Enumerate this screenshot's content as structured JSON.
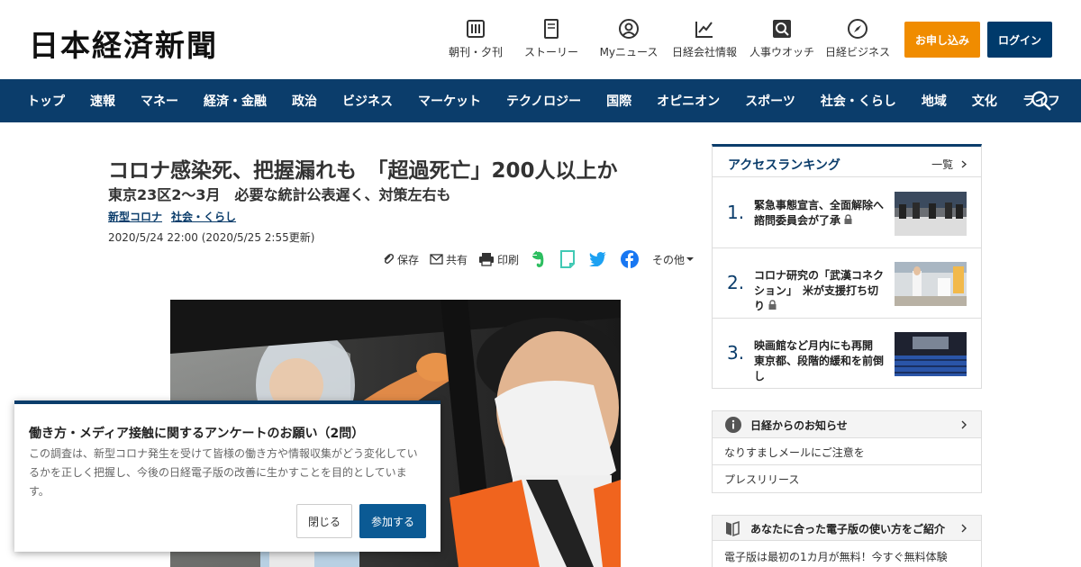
{
  "header": {
    "logo": "日本経済新聞",
    "icons": [
      {
        "label": "朝刊・夕刊",
        "icon": "newspaper-icon"
      },
      {
        "label": "ストーリー",
        "icon": "book-icon"
      },
      {
        "label": "Myニュース",
        "icon": "user-icon"
      },
      {
        "label": "日経会社情報",
        "icon": "chart-icon"
      },
      {
        "label": "人事ウオッチ",
        "icon": "search-person-icon"
      },
      {
        "label": "日経ビジネス",
        "icon": "compass-icon"
      }
    ],
    "apply_label": "お申し込み",
    "login_label": "ログイン"
  },
  "nav": {
    "items": [
      "トップ",
      "速報",
      "マネー",
      "経済・金融",
      "政治",
      "ビジネス",
      "マーケット",
      "テクノロジー",
      "国際",
      "オピニオン",
      "スポーツ",
      "社会・くらし",
      "地域",
      "文化",
      "ライフ"
    ]
  },
  "article": {
    "title": "コロナ感染死、把握漏れも　「超過死亡」200人以上か",
    "subtitle": "東京23区2～3月　必要な統計公表遅く、対策左右も",
    "topics": [
      "新型コロナ",
      "社会・くらし"
    ],
    "date": "2020/5/24 22:00 (2020/5/25 2:55更新)",
    "tools": {
      "save": "保存",
      "share": "共有",
      "print": "印刷",
      "more": "その他"
    }
  },
  "popup": {
    "title": "働き方・メディア接触に関するアンケートのお願い（2問）",
    "body": "この調査は、新型コロナ発生を受けて皆様の働き方や情報収集がどう変化しているかを正しく把握し、今後の日経電子版の改善に生かすことを目的としています。",
    "close_label": "閉じる",
    "join_label": "参加する"
  },
  "ranking": {
    "title": "アクセスランキング",
    "more": "一覧",
    "items": [
      {
        "rank": "1.",
        "text": "緊急事態宣言、全面解除へ　諮問委員会が了承"
      },
      {
        "rank": "2.",
        "text": "コロナ研究の「武漢コネクション」　米が支援打ち切り"
      },
      {
        "rank": "3.",
        "text": "映画館など月内にも再開　東京都、段階的緩和を前倒し"
      }
    ]
  },
  "notice": {
    "title": "日経からのお知らせ",
    "rows": [
      "なりすましメールにご注意を",
      "プレスリリース"
    ]
  },
  "guide": {
    "title": "あなたに合った電子版の使い方をご紹介",
    "row": "電子版は最初の1カ月が無料！今すぐ無料体験"
  },
  "colors": {
    "brand": "#0b3d6b",
    "accent": "#f08c00"
  }
}
